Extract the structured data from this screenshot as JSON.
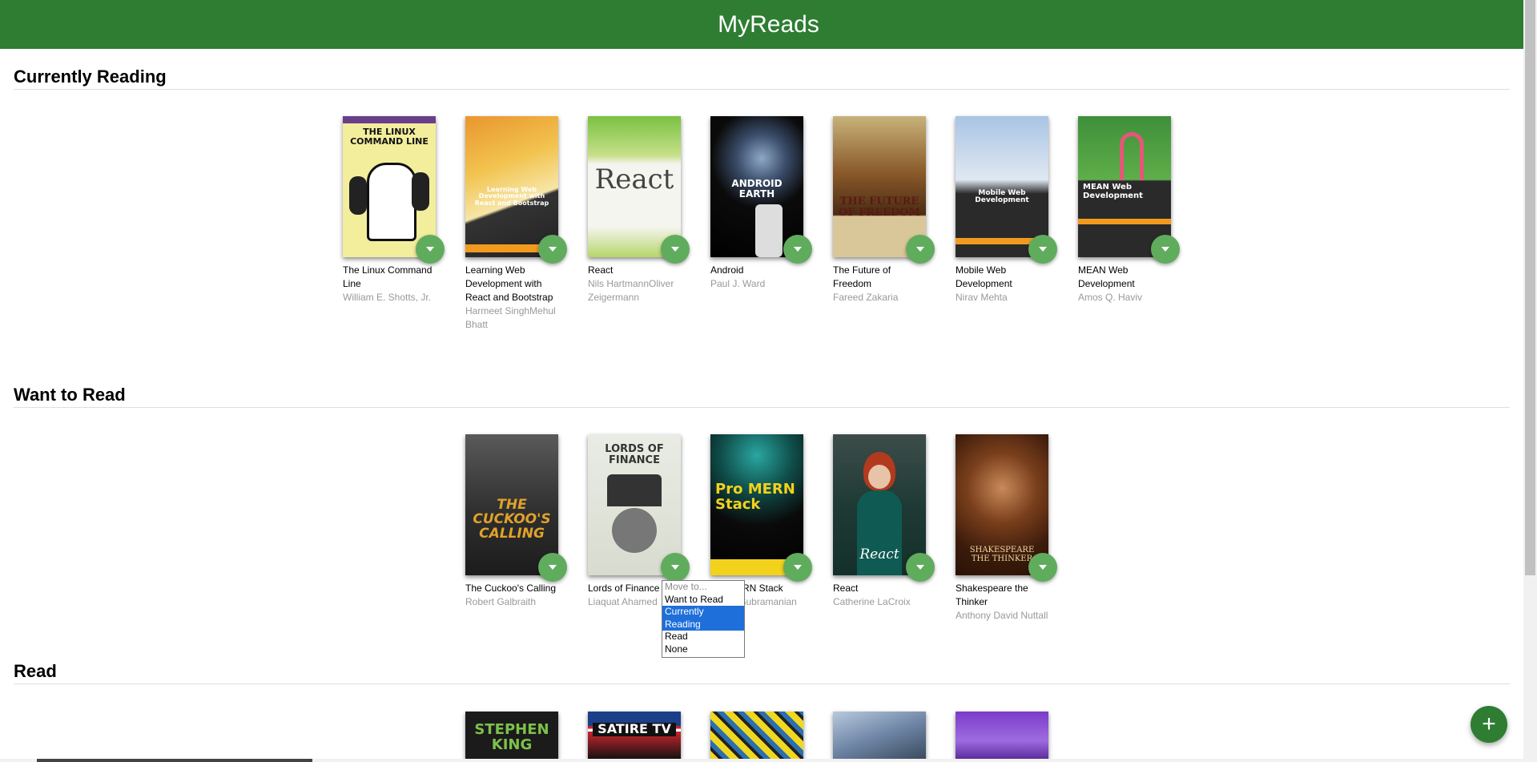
{
  "app": {
    "title": "MyReads"
  },
  "shelves": [
    {
      "title": "Currently Reading"
    },
    {
      "title": "Want to Read"
    },
    {
      "title": "Read"
    }
  ],
  "currently_reading": [
    {
      "title": "The Linux Command Line",
      "authors": "William E. Shotts, Jr.",
      "cover_text": "THE LINUX COMMAND LINE"
    },
    {
      "title": "Learning Web Development with React and Bootstrap",
      "authors": "Harmeet SinghMehul Bhatt",
      "cover_text": "Learning Web Development with React and Bootstrap"
    },
    {
      "title": "React",
      "authors": "Nils HartmannOliver Zeigermann",
      "cover_text": "React"
    },
    {
      "title": "Android",
      "authors": "Paul J. Ward",
      "cover_text": "ANDROID EARTH"
    },
    {
      "title": "The Future of Freedom",
      "authors": "Fareed Zakaria",
      "cover_text": "THE FUTURE OF FREEDOM"
    },
    {
      "title": "Mobile Web Development",
      "authors": "Nirav Mehta",
      "cover_text": "Mobile Web Development"
    },
    {
      "title": "MEAN Web Development",
      "authors": "Amos Q. Haviv",
      "cover_text": "MEAN Web Development"
    }
  ],
  "want_to_read": [
    {
      "title": "The Cuckoo's Calling",
      "authors": "Robert Galbraith",
      "cover_text": "THE CUCKOO'S CALLING"
    },
    {
      "title": "Lords of Finance",
      "authors": "Liaquat Ahamed",
      "cover_text": "LORDS OF FINANCE"
    },
    {
      "title": "Pro MERN Stack",
      "authors": "Vasan Subramanian",
      "cover_text": "Pro MERN Stack"
    },
    {
      "title": "React",
      "authors": "Catherine LaCroix",
      "cover_text": "React"
    },
    {
      "title": "Shakespeare the Thinker",
      "authors": "Anthony David Nuttall",
      "cover_text": "SHAKESPEARE THE THINKER"
    }
  ],
  "read": [
    {
      "cover_text": "STEPHEN KING"
    },
    {
      "cover_text": "SATIRE TV"
    },
    {
      "cover_text": ""
    },
    {
      "cover_text": ""
    },
    {
      "cover_text": ""
    }
  ],
  "shelf_changer_menu": {
    "header": "Move to...",
    "options": [
      "Want to Read",
      "Currently Reading",
      "Read",
      "None"
    ],
    "selected": "Currently Reading"
  },
  "add_button": {
    "label": "+"
  },
  "colors": {
    "header": "#2e7d32",
    "changer": "#60ac5d",
    "fab": "#2e7d32",
    "menu_highlight": "#1e6fd9"
  }
}
